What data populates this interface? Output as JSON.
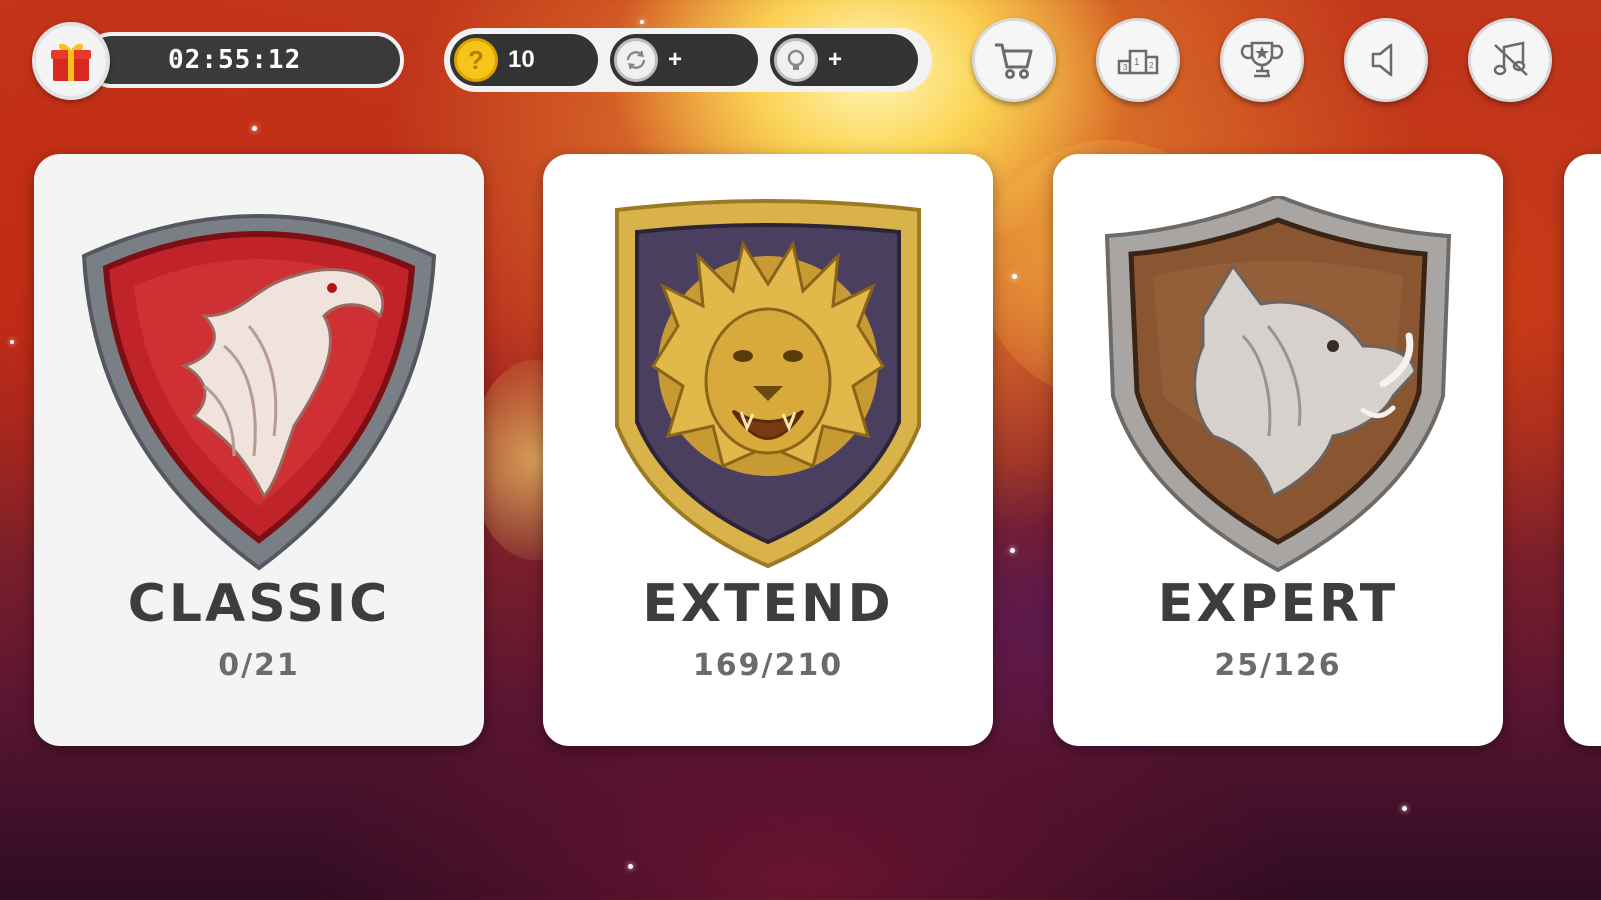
{
  "header": {
    "timer": "02:55:12",
    "coins": "10",
    "refresh_plus": "+",
    "hint_plus": "+"
  },
  "toolbar": {
    "icons": [
      "cart-icon",
      "leaderboard-icon",
      "trophy-icon",
      "sound-icon",
      "music-off-icon"
    ]
  },
  "modes": [
    {
      "title": "CLASSIC",
      "progress": "0/21",
      "emblem": "eagle-shield-icon",
      "color": "#c0242a"
    },
    {
      "title": "EXTEND",
      "progress": "169/210",
      "emblem": "lion-shield-icon",
      "color": "#d9b24a"
    },
    {
      "title": "EXPERT",
      "progress": "25/126",
      "emblem": "boar-shield-icon",
      "color": "#8a5632"
    }
  ],
  "colors": {
    "pill_dark": "#333333",
    "coin_gold": "#f5c518",
    "card_bg": "#f4f4f4",
    "title_text": "#3d3d3d"
  }
}
